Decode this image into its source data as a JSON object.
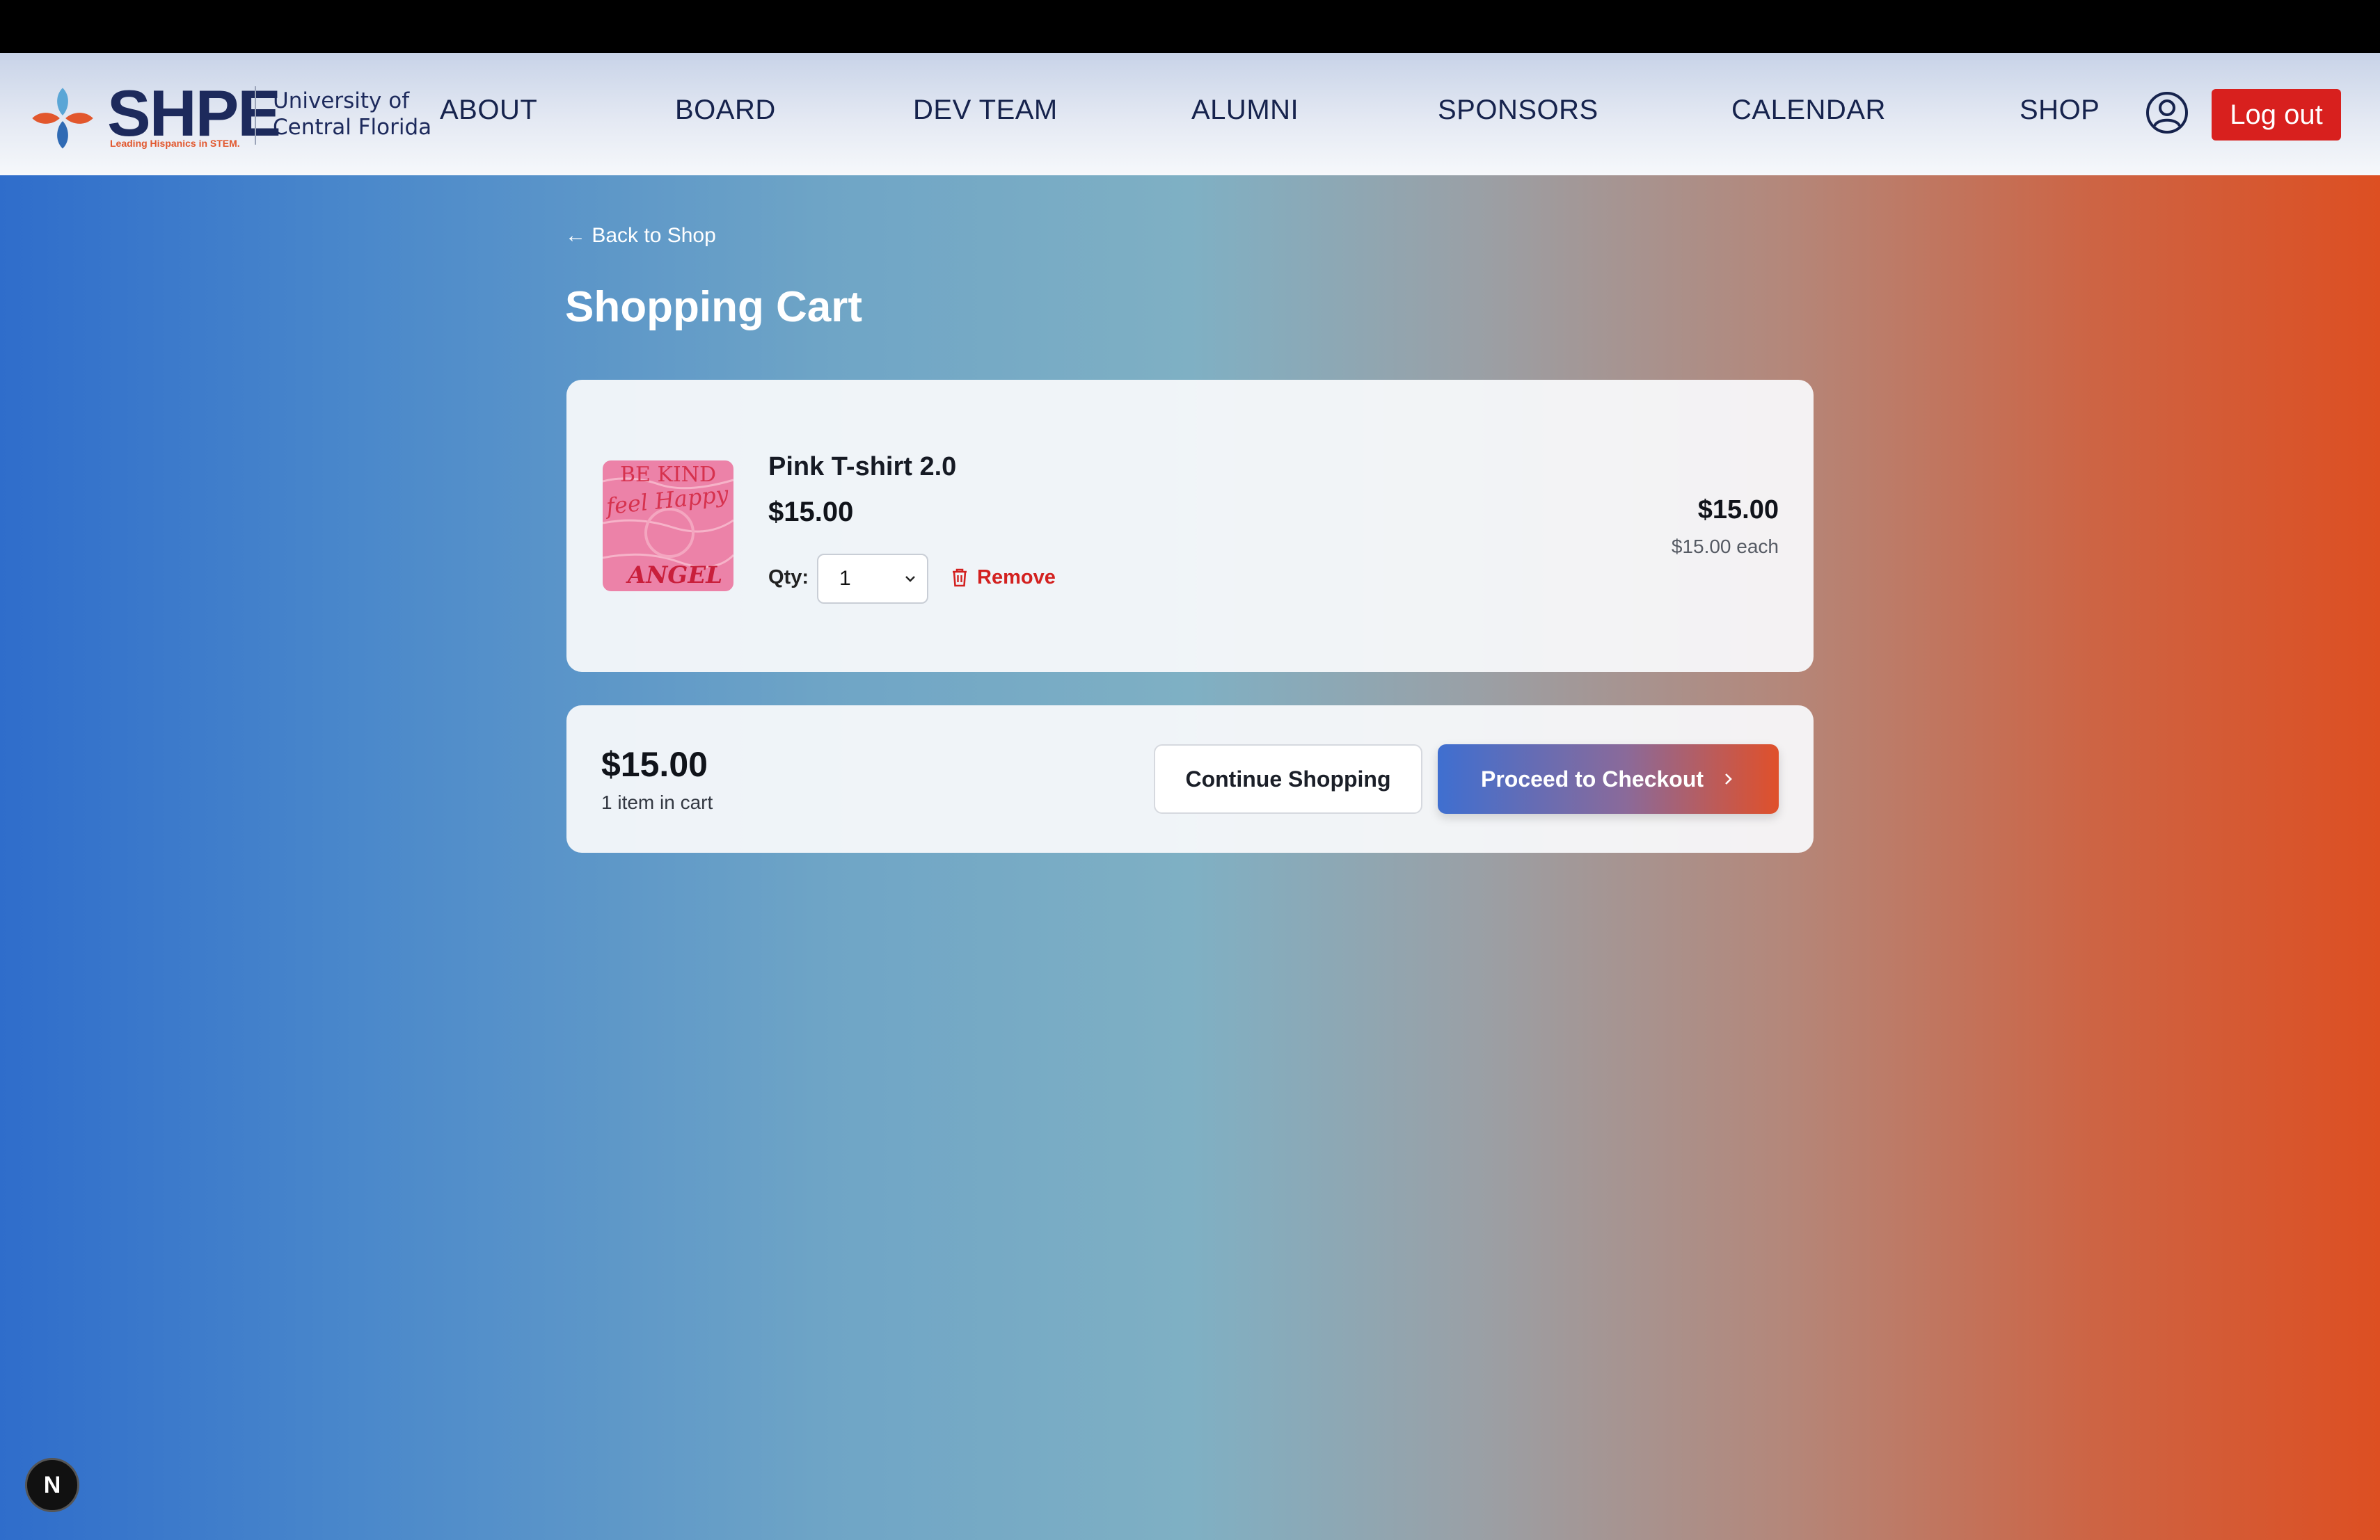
{
  "navbar": {
    "logo_word": "SHPE",
    "logo_tagline": "Leading Hispanics in STEM.",
    "logo_university_line1": "University of",
    "logo_university_line2": "Central Florida",
    "links": [
      "ABOUT",
      "BOARD",
      "DEV TEAM",
      "ALUMNI",
      "SPONSORS",
      "CALENDAR",
      "SHOP"
    ],
    "user_icon": "user-circle-icon",
    "logout_label": "Log out"
  },
  "page": {
    "back_link": "← Back to Shop",
    "title": "Shopping Cart"
  },
  "cart_item": {
    "name": "Pink T-shirt 2.0",
    "price": "$15.00",
    "qty_label": "Qty:",
    "qty_value": "1",
    "remove_label": "Remove",
    "line_total": "$15.00",
    "each_price": "$15.00 each",
    "thumbnail_text_top": "BE KIND",
    "thumbnail_text_mid": "feel Happy",
    "thumbnail_text_bottom": "ANGEL"
  },
  "summary": {
    "total": "$15.00",
    "count": "1 item in cart",
    "continue_label": "Continue Shopping",
    "checkout_label": "Proceed to Checkout"
  },
  "dev_badge": {
    "letter": "N"
  },
  "colors": {
    "brand_navy": "#1d2a5c",
    "brand_orange": "#e2572d",
    "logout_red": "#d8201e",
    "remove_red": "#d32120"
  }
}
